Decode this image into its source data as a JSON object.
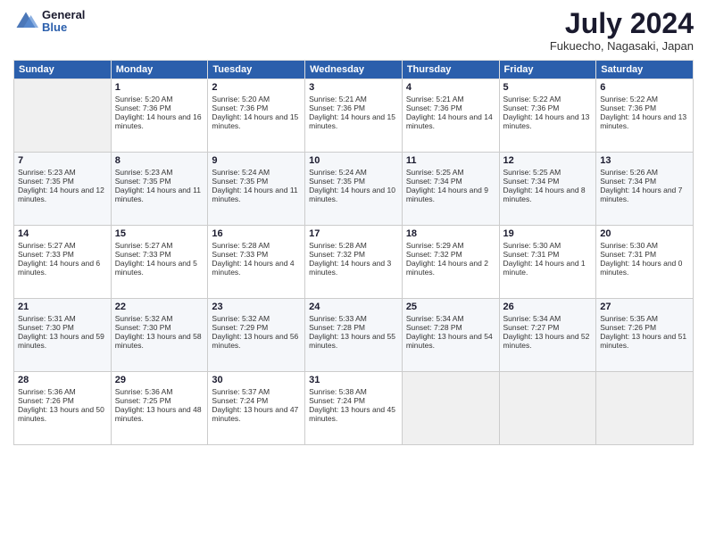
{
  "header": {
    "logo_general": "General",
    "logo_blue": "Blue",
    "month": "July 2024",
    "location": "Fukuecho, Nagasaki, Japan"
  },
  "days_of_week": [
    "Sunday",
    "Monday",
    "Tuesday",
    "Wednesday",
    "Thursday",
    "Friday",
    "Saturday"
  ],
  "weeks": [
    [
      {
        "day": "",
        "empty": true
      },
      {
        "day": "1",
        "sunrise": "Sunrise: 5:20 AM",
        "sunset": "Sunset: 7:36 PM",
        "daylight": "Daylight: 14 hours and 16 minutes."
      },
      {
        "day": "2",
        "sunrise": "Sunrise: 5:20 AM",
        "sunset": "Sunset: 7:36 PM",
        "daylight": "Daylight: 14 hours and 15 minutes."
      },
      {
        "day": "3",
        "sunrise": "Sunrise: 5:21 AM",
        "sunset": "Sunset: 7:36 PM",
        "daylight": "Daylight: 14 hours and 15 minutes."
      },
      {
        "day": "4",
        "sunrise": "Sunrise: 5:21 AM",
        "sunset": "Sunset: 7:36 PM",
        "daylight": "Daylight: 14 hours and 14 minutes."
      },
      {
        "day": "5",
        "sunrise": "Sunrise: 5:22 AM",
        "sunset": "Sunset: 7:36 PM",
        "daylight": "Daylight: 14 hours and 13 minutes."
      },
      {
        "day": "6",
        "sunrise": "Sunrise: 5:22 AM",
        "sunset": "Sunset: 7:36 PM",
        "daylight": "Daylight: 14 hours and 13 minutes."
      }
    ],
    [
      {
        "day": "7",
        "sunrise": "Sunrise: 5:23 AM",
        "sunset": "Sunset: 7:35 PM",
        "daylight": "Daylight: 14 hours and 12 minutes."
      },
      {
        "day": "8",
        "sunrise": "Sunrise: 5:23 AM",
        "sunset": "Sunset: 7:35 PM",
        "daylight": "Daylight: 14 hours and 11 minutes."
      },
      {
        "day": "9",
        "sunrise": "Sunrise: 5:24 AM",
        "sunset": "Sunset: 7:35 PM",
        "daylight": "Daylight: 14 hours and 11 minutes."
      },
      {
        "day": "10",
        "sunrise": "Sunrise: 5:24 AM",
        "sunset": "Sunset: 7:35 PM",
        "daylight": "Daylight: 14 hours and 10 minutes."
      },
      {
        "day": "11",
        "sunrise": "Sunrise: 5:25 AM",
        "sunset": "Sunset: 7:34 PM",
        "daylight": "Daylight: 14 hours and 9 minutes."
      },
      {
        "day": "12",
        "sunrise": "Sunrise: 5:25 AM",
        "sunset": "Sunset: 7:34 PM",
        "daylight": "Daylight: 14 hours and 8 minutes."
      },
      {
        "day": "13",
        "sunrise": "Sunrise: 5:26 AM",
        "sunset": "Sunset: 7:34 PM",
        "daylight": "Daylight: 14 hours and 7 minutes."
      }
    ],
    [
      {
        "day": "14",
        "sunrise": "Sunrise: 5:27 AM",
        "sunset": "Sunset: 7:33 PM",
        "daylight": "Daylight: 14 hours and 6 minutes."
      },
      {
        "day": "15",
        "sunrise": "Sunrise: 5:27 AM",
        "sunset": "Sunset: 7:33 PM",
        "daylight": "Daylight: 14 hours and 5 minutes."
      },
      {
        "day": "16",
        "sunrise": "Sunrise: 5:28 AM",
        "sunset": "Sunset: 7:33 PM",
        "daylight": "Daylight: 14 hours and 4 minutes."
      },
      {
        "day": "17",
        "sunrise": "Sunrise: 5:28 AM",
        "sunset": "Sunset: 7:32 PM",
        "daylight": "Daylight: 14 hours and 3 minutes."
      },
      {
        "day": "18",
        "sunrise": "Sunrise: 5:29 AM",
        "sunset": "Sunset: 7:32 PM",
        "daylight": "Daylight: 14 hours and 2 minutes."
      },
      {
        "day": "19",
        "sunrise": "Sunrise: 5:30 AM",
        "sunset": "Sunset: 7:31 PM",
        "daylight": "Daylight: 14 hours and 1 minute."
      },
      {
        "day": "20",
        "sunrise": "Sunrise: 5:30 AM",
        "sunset": "Sunset: 7:31 PM",
        "daylight": "Daylight: 14 hours and 0 minutes."
      }
    ],
    [
      {
        "day": "21",
        "sunrise": "Sunrise: 5:31 AM",
        "sunset": "Sunset: 7:30 PM",
        "daylight": "Daylight: 13 hours and 59 minutes."
      },
      {
        "day": "22",
        "sunrise": "Sunrise: 5:32 AM",
        "sunset": "Sunset: 7:30 PM",
        "daylight": "Daylight: 13 hours and 58 minutes."
      },
      {
        "day": "23",
        "sunrise": "Sunrise: 5:32 AM",
        "sunset": "Sunset: 7:29 PM",
        "daylight": "Daylight: 13 hours and 56 minutes."
      },
      {
        "day": "24",
        "sunrise": "Sunrise: 5:33 AM",
        "sunset": "Sunset: 7:28 PM",
        "daylight": "Daylight: 13 hours and 55 minutes."
      },
      {
        "day": "25",
        "sunrise": "Sunrise: 5:34 AM",
        "sunset": "Sunset: 7:28 PM",
        "daylight": "Daylight: 13 hours and 54 minutes."
      },
      {
        "day": "26",
        "sunrise": "Sunrise: 5:34 AM",
        "sunset": "Sunset: 7:27 PM",
        "daylight": "Daylight: 13 hours and 52 minutes."
      },
      {
        "day": "27",
        "sunrise": "Sunrise: 5:35 AM",
        "sunset": "Sunset: 7:26 PM",
        "daylight": "Daylight: 13 hours and 51 minutes."
      }
    ],
    [
      {
        "day": "28",
        "sunrise": "Sunrise: 5:36 AM",
        "sunset": "Sunset: 7:26 PM",
        "daylight": "Daylight: 13 hours and 50 minutes."
      },
      {
        "day": "29",
        "sunrise": "Sunrise: 5:36 AM",
        "sunset": "Sunset: 7:25 PM",
        "daylight": "Daylight: 13 hours and 48 minutes."
      },
      {
        "day": "30",
        "sunrise": "Sunrise: 5:37 AM",
        "sunset": "Sunset: 7:24 PM",
        "daylight": "Daylight: 13 hours and 47 minutes."
      },
      {
        "day": "31",
        "sunrise": "Sunrise: 5:38 AM",
        "sunset": "Sunset: 7:24 PM",
        "daylight": "Daylight: 13 hours and 45 minutes."
      },
      {
        "day": "",
        "empty": true
      },
      {
        "day": "",
        "empty": true
      },
      {
        "day": "",
        "empty": true
      }
    ]
  ]
}
